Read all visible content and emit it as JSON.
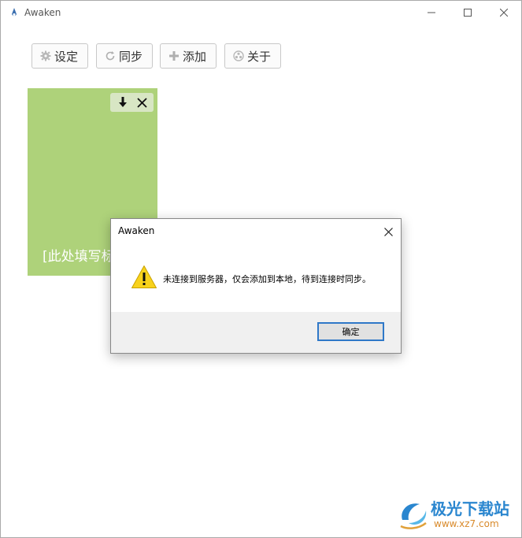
{
  "window": {
    "title": "Awaken"
  },
  "toolbar": {
    "settings_label": "设定",
    "sync_label": "同步",
    "add_label": "添加",
    "about_label": "关于"
  },
  "note_card": {
    "text": "[此处填写标",
    "color": "#aed27a"
  },
  "dialog": {
    "title": "Awaken",
    "message": "未连接到服务器，仅会添加到本地，待到连接时同步。",
    "ok_label": "确定",
    "icon": "warning-icon"
  },
  "watermark": {
    "name": "极光下载站",
    "url": "www.xz7.com"
  }
}
